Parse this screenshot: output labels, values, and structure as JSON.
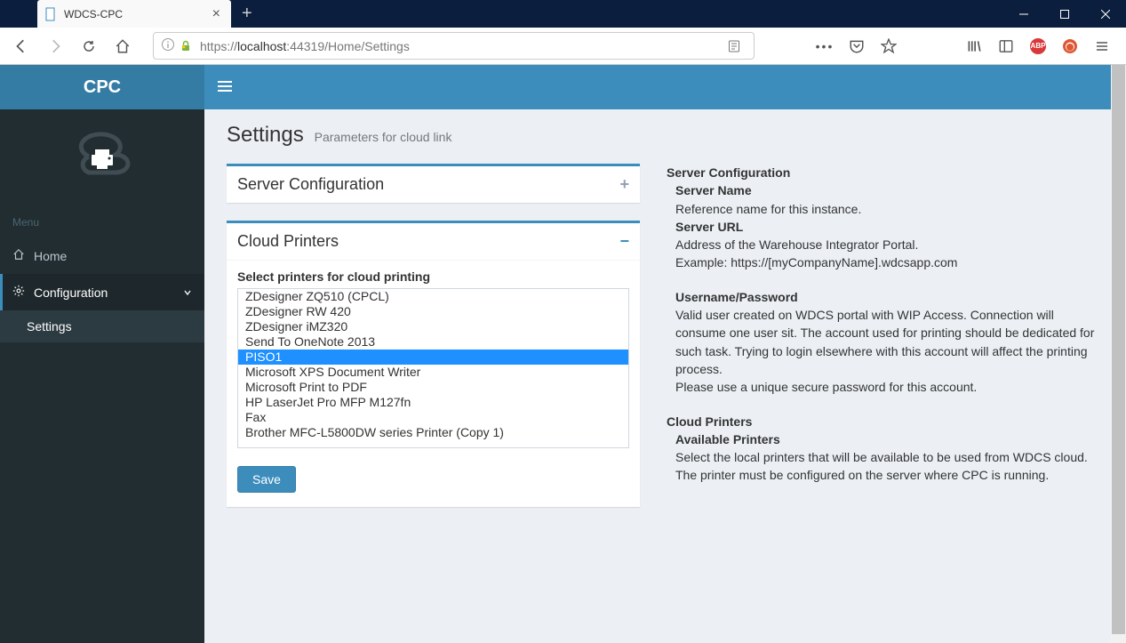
{
  "browser": {
    "tab_title": "WDCS-CPC",
    "url_prefix": "https://",
    "url_host": "localhost",
    "url_rest": ":44319/Home/Settings"
  },
  "brand": "CPC",
  "menu": {
    "header": "Menu",
    "home": "Home",
    "configuration": "Configuration",
    "settings": "Settings"
  },
  "page": {
    "title": "Settings",
    "subtitle": "Parameters for cloud link"
  },
  "panels": {
    "server_config_title": "Server Configuration",
    "cloud_printers_title": "Cloud Printers",
    "select_printers_label": "Select printers for cloud printing",
    "save_label": "Save"
  },
  "printers": [
    "ZDesigner ZQ510 (CPCL)",
    "ZDesigner RW 420",
    "ZDesigner iMZ320",
    "Send To OneNote 2013",
    "PISO1",
    "Microsoft XPS Document Writer",
    "Microsoft Print to PDF",
    "HP LaserJet Pro MFP M127fn",
    "Fax",
    "Brother MFC-L5800DW series Printer (Copy 1)"
  ],
  "printer_selected_index": 4,
  "help": {
    "sc_title": "Server Configuration",
    "sn_title": "Server Name",
    "sn_desc": "Reference name for this instance.",
    "su_title": "Server URL",
    "su_desc1": "Address of the Warehouse Integrator Portal.",
    "su_desc2": "Example: https://[myCompanyName].wdcsapp.com",
    "up_title": "Username/Password",
    "up_desc1": "Valid user created on WDCS portal with WIP Access. Connection will consume one user sit. The account used for printing should be dedicated for such task. Trying to login elsewhere with this account will affect the printing process.",
    "up_desc2": "Please use a unique secure password for this account.",
    "cp_title": "Cloud Printers",
    "ap_title": "Available Printers",
    "ap_desc1": "Select the local printers that will be available to be used from WDCS cloud.",
    "ap_desc2": "The printer must be configured on the server where CPC is running."
  }
}
